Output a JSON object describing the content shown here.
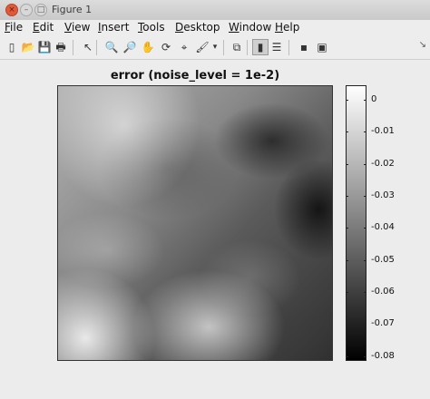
{
  "window": {
    "title": "Figure 1",
    "close_glyph": "×",
    "min_glyph": "–",
    "max_glyph": "□"
  },
  "menubar": {
    "items": [
      {
        "label": "File",
        "key": "F"
      },
      {
        "label": "Edit",
        "key": "E"
      },
      {
        "label": "View",
        "key": "V"
      },
      {
        "label": "Insert",
        "key": "I"
      },
      {
        "label": "Tools",
        "key": "T"
      },
      {
        "label": "Desktop",
        "key": "D"
      },
      {
        "label": "Window",
        "key": "W"
      },
      {
        "label": "Help",
        "key": "H"
      }
    ]
  },
  "toolbar": {
    "tools": [
      {
        "name": "new-figure-icon",
        "glyph": "▯"
      },
      {
        "name": "open-file-icon",
        "glyph": "📂"
      },
      {
        "name": "save-icon",
        "glyph": "💾"
      },
      {
        "name": "print-icon",
        "glyph": "🖶"
      },
      {
        "name": "edit-plot-arrow-icon",
        "glyph": "↖"
      },
      {
        "name": "zoom-in-icon",
        "glyph": "🔍"
      },
      {
        "name": "zoom-out-icon",
        "glyph": "🔎"
      },
      {
        "name": "pan-hand-icon",
        "glyph": "✋"
      },
      {
        "name": "rotate-3d-icon",
        "glyph": "⟳"
      },
      {
        "name": "data-cursor-icon",
        "glyph": "⌖"
      },
      {
        "name": "brush-icon",
        "glyph": "🖌"
      },
      {
        "name": "brush-dropdown-icon",
        "glyph": "▾"
      },
      {
        "name": "link-plot-icon",
        "glyph": "⧉"
      },
      {
        "name": "insert-colorbar-icon",
        "glyph": "▮"
      },
      {
        "name": "insert-legend-icon",
        "glyph": "☰"
      },
      {
        "name": "hide-plot-tools-icon",
        "glyph": "▪"
      },
      {
        "name": "show-plot-tools-icon",
        "glyph": "▣"
      }
    ],
    "corner_glyph": "↘"
  },
  "plot": {
    "title": "error (noise_level = 1e-2)",
    "colormap": "gray",
    "colorbar": {
      "ticks": [
        "0",
        "-0.01",
        "-0.02",
        "-0.03",
        "-0.04",
        "-0.05",
        "-0.06",
        "-0.07",
        "-0.08"
      ],
      "range": [
        -0.0815,
        0.0045
      ]
    }
  },
  "colors": {
    "window_bg": "#ececec",
    "close_button": "#e05a3a"
  }
}
